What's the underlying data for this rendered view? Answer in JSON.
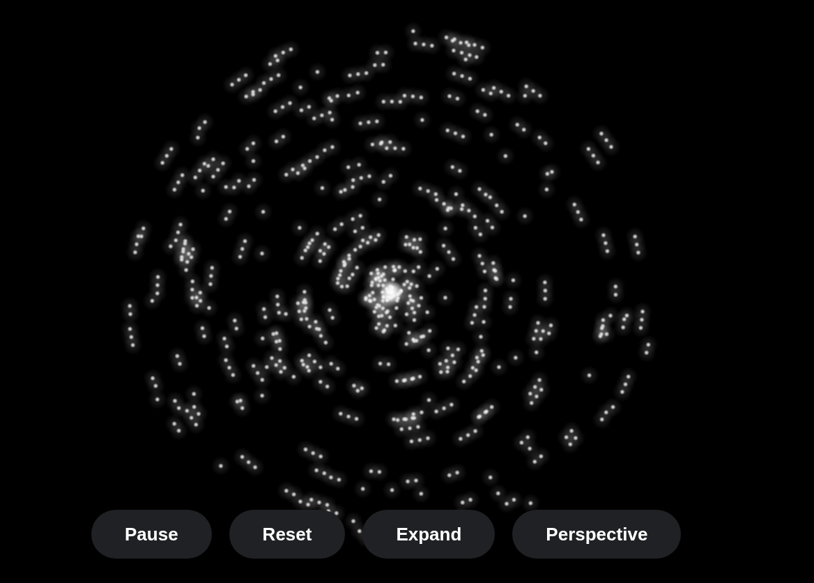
{
  "buttons": [
    {
      "label": "Pause"
    },
    {
      "label": "Reset"
    },
    {
      "label": "Expand"
    },
    {
      "label": "Perspective"
    }
  ]
}
